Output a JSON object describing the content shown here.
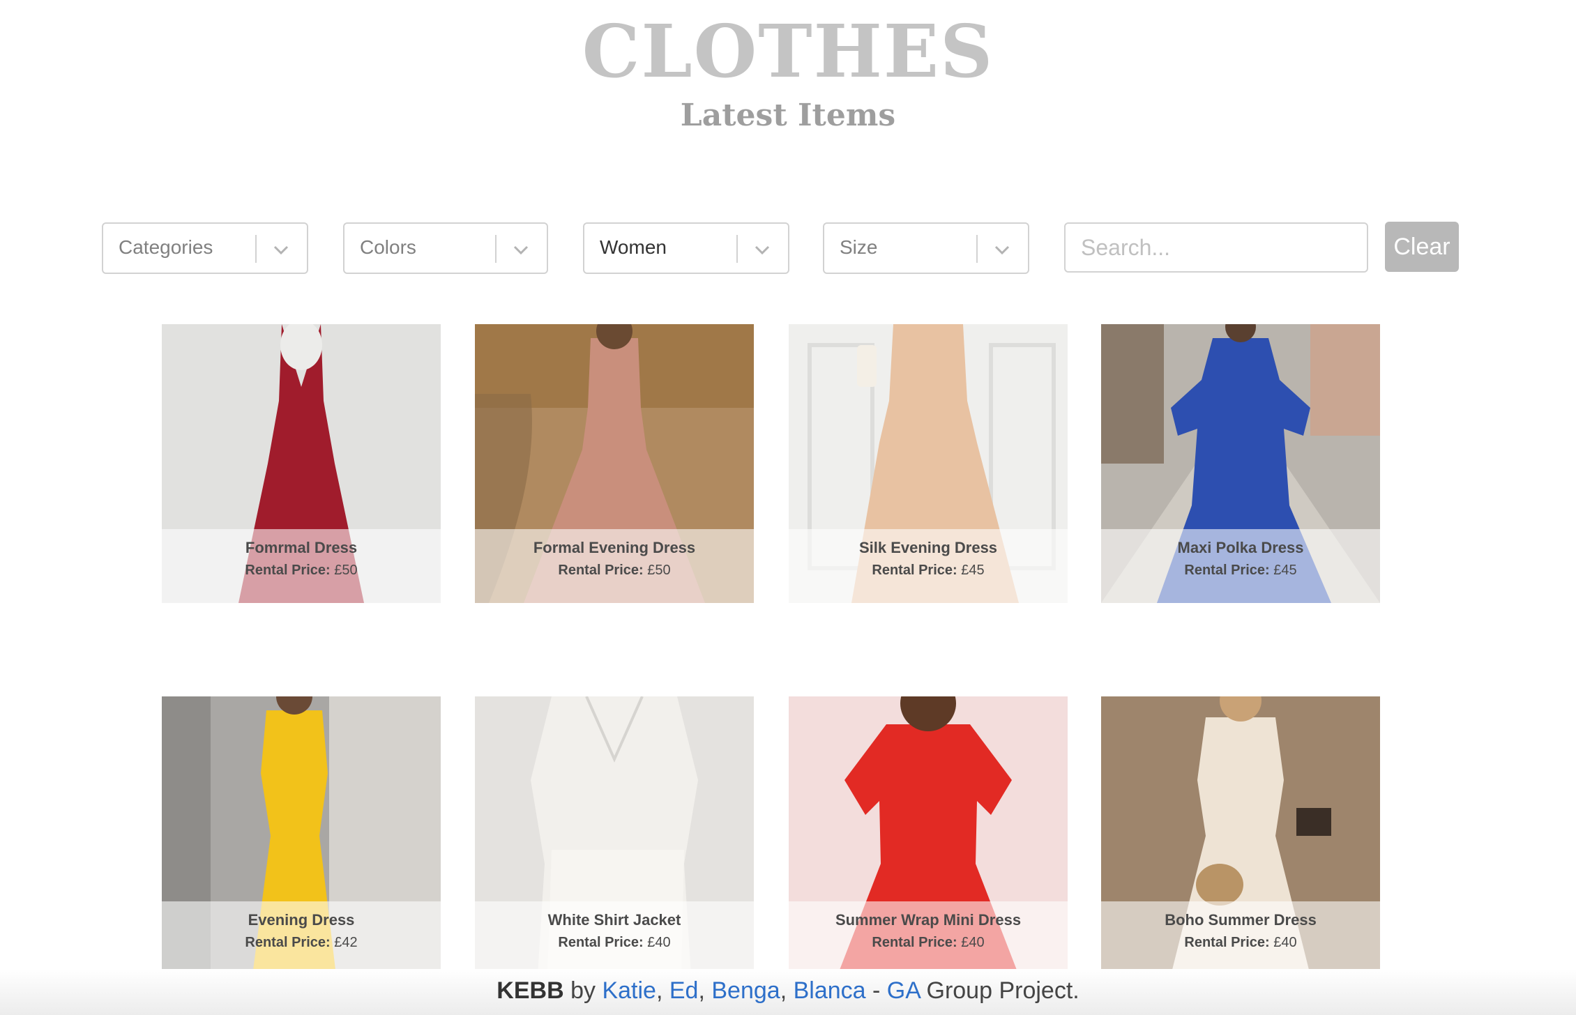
{
  "header": {
    "title": "CLOTHES",
    "subtitle": "Latest Items"
  },
  "filters": {
    "categories": "Categories",
    "colors": "Colors",
    "gender": "Women",
    "size": "Size",
    "search_placeholder": "Search...",
    "clear_label": "Clear",
    "chevron_icon": "chevron-down-icon"
  },
  "price_label": "Rental Price:",
  "items": [
    {
      "name": "Fomrmal Dress",
      "price": "£50",
      "color": "#a01c2c"
    },
    {
      "name": "Formal Evening Dress",
      "price": "£50",
      "color": "#c98f7c"
    },
    {
      "name": "Silk Evening Dress",
      "price": "£45",
      "color": "#e8c2a2"
    },
    {
      "name": "Maxi Polka Dress",
      "price": "£45",
      "color": "#2d4fb0"
    },
    {
      "name": "Evening Dress",
      "price": "£42",
      "color": "#f2c21a"
    },
    {
      "name": "White Shirt Jacket",
      "price": "£40",
      "color": "#f2f0ec"
    },
    {
      "name": "Summer Wrap Mini Dress",
      "price": "£40",
      "color": "#e22a24"
    },
    {
      "name": "Boho Summer Dress",
      "price": "£40",
      "color": "#eee3d4"
    }
  ],
  "footer": {
    "brand": "KEBB",
    "by": "by",
    "authors": [
      "Katie",
      "Ed",
      "Benga",
      "Blanca"
    ],
    "separator": ",",
    "dash": "-",
    "org": "GA",
    "suffix": "Group Project."
  }
}
